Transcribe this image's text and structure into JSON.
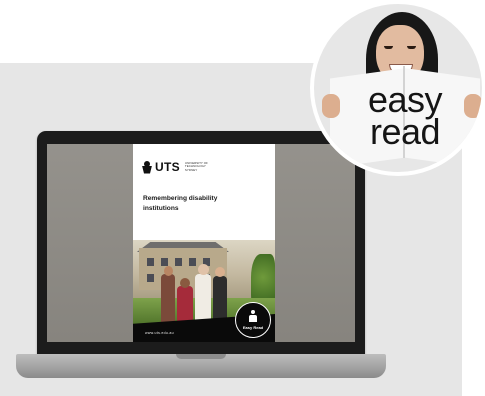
{
  "laptop": {
    "document": {
      "logo_text": "UTS",
      "logo_sub": "UNIVERSITY OF TECHNOLOGY SYDNEY",
      "title": "Remembering disability institutions",
      "url": "www.uts.edu.au",
      "badge_label": "Easy Read"
    }
  },
  "badge_circle": {
    "line1": "easy",
    "line2": "read"
  }
}
